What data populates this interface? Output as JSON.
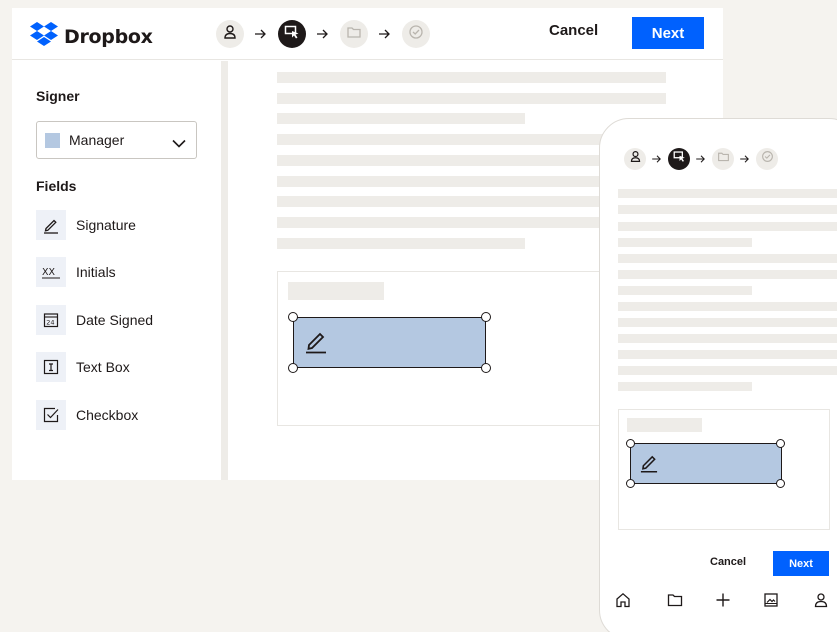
{
  "brand": {
    "name": "Dropbox",
    "color": "#0061fe"
  },
  "stepper": {
    "steps": [
      {
        "icon": "person-icon",
        "state": "done"
      },
      {
        "icon": "place-fields-icon",
        "state": "active"
      },
      {
        "icon": "folder-icon",
        "state": "upcoming"
      },
      {
        "icon": "check-circle-icon",
        "state": "upcoming"
      }
    ]
  },
  "header": {
    "cancel_label": "Cancel",
    "next_label": "Next"
  },
  "sidebar": {
    "signer_heading": "Signer",
    "signer_select": {
      "value": "Manager",
      "swatch_color": "#b4c8e1"
    },
    "fields_heading": "Fields",
    "fields": [
      {
        "label": "Signature",
        "icon": "pen-icon"
      },
      {
        "label": "Initials",
        "icon": "initials-icon"
      },
      {
        "label": "Date Signed",
        "icon": "calendar-icon"
      },
      {
        "label": "Text Box",
        "icon": "text-box-icon"
      },
      {
        "label": "Checkbox",
        "icon": "checkbox-icon"
      }
    ]
  },
  "document": {
    "signature_field": {
      "icon": "pen-icon",
      "fill_color": "#b4c8e1"
    }
  },
  "mobile": {
    "cancel_label": "Cancel",
    "next_label": "Next",
    "nav": [
      "home-icon",
      "folder-icon",
      "plus-icon",
      "photos-icon",
      "account-icon"
    ]
  }
}
